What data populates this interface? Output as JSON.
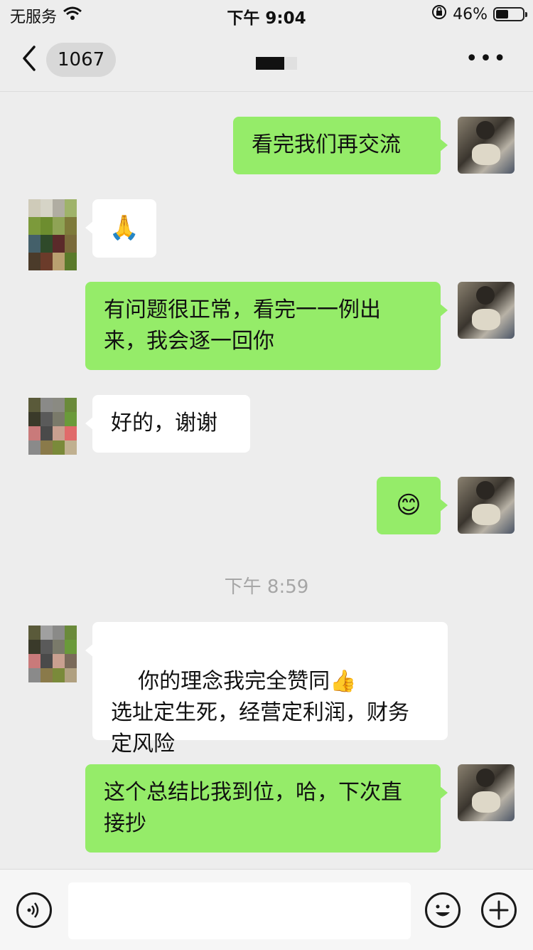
{
  "status_bar": {
    "carrier": "无服务",
    "time": "下午 9:04",
    "battery": "46%",
    "battery_level": 0.46
  },
  "header": {
    "unread_count": "1067",
    "more_label": "•••"
  },
  "messages": [
    {
      "direction": "out",
      "text": "看完我们再交流"
    },
    {
      "direction": "in",
      "text": "🙏"
    },
    {
      "direction": "out",
      "text": "有问题很正常，看完一一例出来，我会逐一回你"
    },
    {
      "direction": "in",
      "text": "好的，谢谢"
    },
    {
      "direction": "out",
      "text": "😊"
    },
    {
      "direction": "in",
      "text": "你的理念我完全赞同👍\n选址定生死，经营定利润，财务定风险"
    },
    {
      "direction": "out",
      "text": "这个总结比我到位，哈，下次直接抄"
    }
  ],
  "timestamp": "下午 8:59",
  "colors": {
    "outgoing_bubble": "#95ec69",
    "incoming_bubble": "#ffffff",
    "background": "#ededed"
  }
}
